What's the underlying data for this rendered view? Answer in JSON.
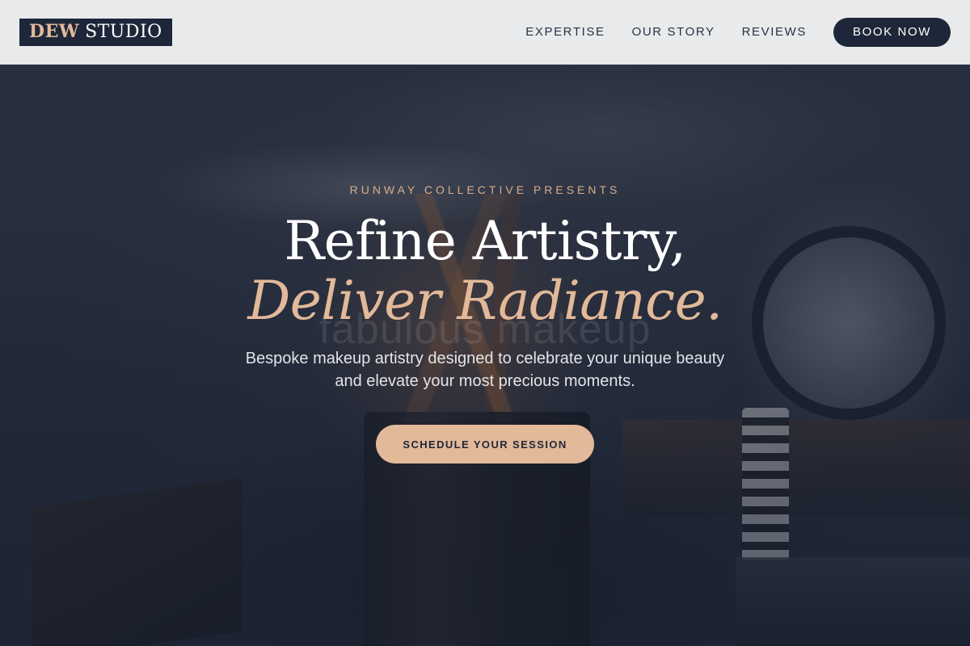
{
  "brand": {
    "accent_word": "DEW",
    "main_word": "STUDIO"
  },
  "nav": {
    "items": [
      {
        "label": "EXPERTISE"
      },
      {
        "label": "OUR STORY"
      },
      {
        "label": "REVIEWS"
      }
    ],
    "book_label": "BOOK NOW"
  },
  "hero": {
    "eyebrow": "RUNWAY COLLECTIVE PRESENTS",
    "headline_line1": "Refine Artistry,",
    "headline_line2": "Deliver Radiance.",
    "background_watermark": "fabulous makeup",
    "subtitle": "Bespoke makeup artistry designed to celebrate your unique beauty and elevate your most precious moments.",
    "cta_label": "SCHEDULE YOUR SESSION"
  },
  "colors": {
    "navy": "#1e2739",
    "accent_peach": "#e2b999",
    "header_bg": "#f0f1f4"
  }
}
